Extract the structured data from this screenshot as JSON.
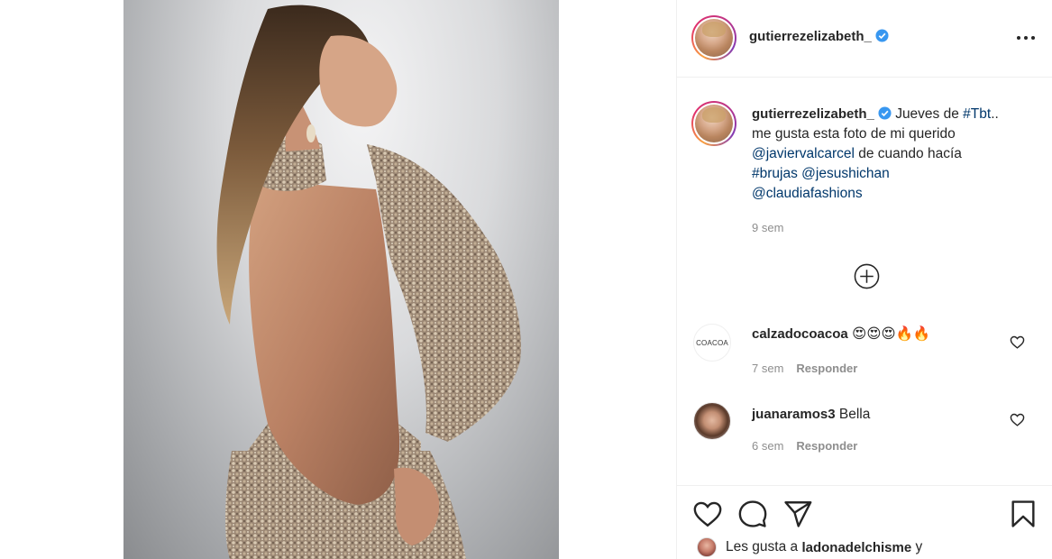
{
  "post": {
    "author": "gutierrezelizabeth_",
    "verified_color": "#3897f0"
  },
  "caption": {
    "author": "gutierrezelizabeth_",
    "text_1": "Jueves de",
    "tag_tbt": "#Tbt",
    "text_2": "..",
    "line_2": "me gusta esta foto de mi querido",
    "mention_1": "@javiervalcarcel",
    "text_3": "de cuando hacía",
    "tag_brujas": "#brujas",
    "mention_2": "@jesushichan",
    "mention_3": "@claudiafashions",
    "time": "9 sem"
  },
  "comments": [
    {
      "user": "calzadocoacoa",
      "avatar_text": "COACOA",
      "text": "😍😍😍🔥🔥",
      "time": "7 sem",
      "reply": "Responder"
    },
    {
      "user": "juanaramos3",
      "text": "Bella",
      "time": "6 sem",
      "reply": "Responder"
    }
  ],
  "likes": {
    "prefix": "Les gusta a",
    "user": "ladonadelchisme",
    "suffix": "y"
  },
  "icons": {
    "more": "more-options-icon",
    "verified": "verified-badge-icon",
    "load_more": "plus-circle-icon",
    "like": "heart-icon",
    "comment": "comment-bubble-icon",
    "share": "paper-plane-icon",
    "save": "bookmark-icon"
  },
  "colors": {
    "text": "#262626",
    "secondary": "#8e8e8e",
    "link": "#00376b",
    "divider": "#efefef"
  }
}
